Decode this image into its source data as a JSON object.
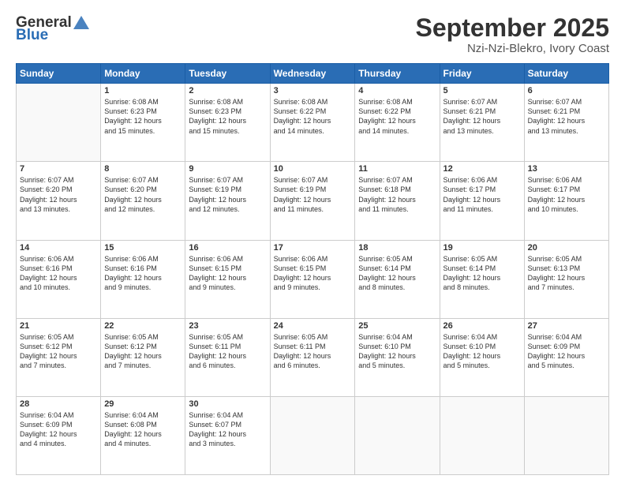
{
  "header": {
    "logo_general": "General",
    "logo_blue": "Blue",
    "month": "September 2025",
    "location": "Nzi-Nzi-Blekro, Ivory Coast"
  },
  "weekdays": [
    "Sunday",
    "Monday",
    "Tuesday",
    "Wednesday",
    "Thursday",
    "Friday",
    "Saturday"
  ],
  "weeks": [
    [
      {
        "day": "",
        "info": ""
      },
      {
        "day": "1",
        "info": "Sunrise: 6:08 AM\nSunset: 6:23 PM\nDaylight: 12 hours\nand 15 minutes."
      },
      {
        "day": "2",
        "info": "Sunrise: 6:08 AM\nSunset: 6:23 PM\nDaylight: 12 hours\nand 15 minutes."
      },
      {
        "day": "3",
        "info": "Sunrise: 6:08 AM\nSunset: 6:22 PM\nDaylight: 12 hours\nand 14 minutes."
      },
      {
        "day": "4",
        "info": "Sunrise: 6:08 AM\nSunset: 6:22 PM\nDaylight: 12 hours\nand 14 minutes."
      },
      {
        "day": "5",
        "info": "Sunrise: 6:07 AM\nSunset: 6:21 PM\nDaylight: 12 hours\nand 13 minutes."
      },
      {
        "day": "6",
        "info": "Sunrise: 6:07 AM\nSunset: 6:21 PM\nDaylight: 12 hours\nand 13 minutes."
      }
    ],
    [
      {
        "day": "7",
        "info": "Sunrise: 6:07 AM\nSunset: 6:20 PM\nDaylight: 12 hours\nand 13 minutes."
      },
      {
        "day": "8",
        "info": "Sunrise: 6:07 AM\nSunset: 6:20 PM\nDaylight: 12 hours\nand 12 minutes."
      },
      {
        "day": "9",
        "info": "Sunrise: 6:07 AM\nSunset: 6:19 PM\nDaylight: 12 hours\nand 12 minutes."
      },
      {
        "day": "10",
        "info": "Sunrise: 6:07 AM\nSunset: 6:19 PM\nDaylight: 12 hours\nand 11 minutes."
      },
      {
        "day": "11",
        "info": "Sunrise: 6:07 AM\nSunset: 6:18 PM\nDaylight: 12 hours\nand 11 minutes."
      },
      {
        "day": "12",
        "info": "Sunrise: 6:06 AM\nSunset: 6:17 PM\nDaylight: 12 hours\nand 11 minutes."
      },
      {
        "day": "13",
        "info": "Sunrise: 6:06 AM\nSunset: 6:17 PM\nDaylight: 12 hours\nand 10 minutes."
      }
    ],
    [
      {
        "day": "14",
        "info": "Sunrise: 6:06 AM\nSunset: 6:16 PM\nDaylight: 12 hours\nand 10 minutes."
      },
      {
        "day": "15",
        "info": "Sunrise: 6:06 AM\nSunset: 6:16 PM\nDaylight: 12 hours\nand 9 minutes."
      },
      {
        "day": "16",
        "info": "Sunrise: 6:06 AM\nSunset: 6:15 PM\nDaylight: 12 hours\nand 9 minutes."
      },
      {
        "day": "17",
        "info": "Sunrise: 6:06 AM\nSunset: 6:15 PM\nDaylight: 12 hours\nand 9 minutes."
      },
      {
        "day": "18",
        "info": "Sunrise: 6:05 AM\nSunset: 6:14 PM\nDaylight: 12 hours\nand 8 minutes."
      },
      {
        "day": "19",
        "info": "Sunrise: 6:05 AM\nSunset: 6:14 PM\nDaylight: 12 hours\nand 8 minutes."
      },
      {
        "day": "20",
        "info": "Sunrise: 6:05 AM\nSunset: 6:13 PM\nDaylight: 12 hours\nand 7 minutes."
      }
    ],
    [
      {
        "day": "21",
        "info": "Sunrise: 6:05 AM\nSunset: 6:12 PM\nDaylight: 12 hours\nand 7 minutes."
      },
      {
        "day": "22",
        "info": "Sunrise: 6:05 AM\nSunset: 6:12 PM\nDaylight: 12 hours\nand 7 minutes."
      },
      {
        "day": "23",
        "info": "Sunrise: 6:05 AM\nSunset: 6:11 PM\nDaylight: 12 hours\nand 6 minutes."
      },
      {
        "day": "24",
        "info": "Sunrise: 6:05 AM\nSunset: 6:11 PM\nDaylight: 12 hours\nand 6 minutes."
      },
      {
        "day": "25",
        "info": "Sunrise: 6:04 AM\nSunset: 6:10 PM\nDaylight: 12 hours\nand 5 minutes."
      },
      {
        "day": "26",
        "info": "Sunrise: 6:04 AM\nSunset: 6:10 PM\nDaylight: 12 hours\nand 5 minutes."
      },
      {
        "day": "27",
        "info": "Sunrise: 6:04 AM\nSunset: 6:09 PM\nDaylight: 12 hours\nand 5 minutes."
      }
    ],
    [
      {
        "day": "28",
        "info": "Sunrise: 6:04 AM\nSunset: 6:09 PM\nDaylight: 12 hours\nand 4 minutes."
      },
      {
        "day": "29",
        "info": "Sunrise: 6:04 AM\nSunset: 6:08 PM\nDaylight: 12 hours\nand 4 minutes."
      },
      {
        "day": "30",
        "info": "Sunrise: 6:04 AM\nSunset: 6:07 PM\nDaylight: 12 hours\nand 3 minutes."
      },
      {
        "day": "",
        "info": ""
      },
      {
        "day": "",
        "info": ""
      },
      {
        "day": "",
        "info": ""
      },
      {
        "day": "",
        "info": ""
      }
    ]
  ]
}
